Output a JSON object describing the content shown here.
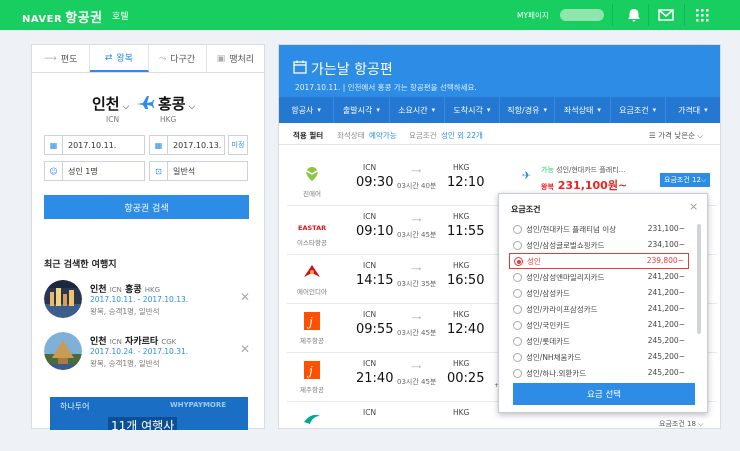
{
  "topbar": {
    "brand": "NAVER",
    "brand_ko": "항공권",
    "nav_hotel": "호텔",
    "mypage": "MY페이지",
    "color": "#19ce60"
  },
  "search": {
    "tabs": [
      {
        "label": "편도",
        "icon": "arrow-right-icon"
      },
      {
        "label": "왕복",
        "icon": "swap-icon",
        "active": true
      },
      {
        "label": "다구간",
        "icon": "multi-city-icon"
      },
      {
        "label": "땡처리",
        "icon": "deal-icon"
      }
    ],
    "from_city": "인천",
    "from_code": "ICN",
    "to_city": "홍콩",
    "to_code": "HKG",
    "depart_date": "2017.10.11.",
    "return_date": "2017.10.13.",
    "undecided": "미정",
    "passengers": "성인 1명",
    "cabin": "일반석",
    "search_button": "항공권 검색"
  },
  "recent": {
    "title": "최근 검색한 여행지",
    "items": [
      {
        "from": "인천",
        "from_code": "ICN",
        "to": "홍콩",
        "to_code": "HKG",
        "dates": "2017.10.11. - 2017.10.13.",
        "info": "왕복, 승객1명, 일반석"
      },
      {
        "from": "인천",
        "from_code": "ICN",
        "to": "자카르타",
        "to_code": "CGK",
        "dates": "2017.10.24. - 2017.10.31.",
        "info": "왕복, 승객1명, 일반석"
      }
    ]
  },
  "ad": {
    "line1": "하나투어",
    "line2": "11개 여행사",
    "line3": "WHYPAYMORE"
  },
  "results": {
    "title": "가는날 항공편",
    "subtitle_date": "2017.10.11.",
    "subtitle_text": "인천에서 홍콩 가는 항공편을 선택하세요.",
    "filters": [
      "항공사",
      "출발시각",
      "소요시간",
      "도착시각",
      "직항/경유",
      "좌석상태",
      "요금조건",
      "가격대"
    ],
    "applied_label": "적용 필터",
    "applied_seat": "좌석상태",
    "applied_seat_value": "예약가능",
    "applied_fare": "요금조건",
    "applied_fare_value": "성인 외 22개",
    "sort": "가격 낮은순",
    "flights": [
      {
        "airline": "진에어",
        "dep_code": "ICN",
        "dep_time": "09:30",
        "duration": "03시간 40분",
        "arr_code": "HKG",
        "arr_time": "12:10",
        "plus_day": "",
        "color": "#8dc63f"
      },
      {
        "airline": "이스타항공",
        "dep_code": "ICN",
        "dep_time": "09:10",
        "duration": "03시간 45분",
        "arr_code": "HKG",
        "arr_time": "11:55",
        "plus_day": "",
        "color": "#d71920"
      },
      {
        "airline": "에어인디아",
        "dep_code": "ICN",
        "dep_time": "14:15",
        "duration": "03시간 35분",
        "arr_code": "HKG",
        "arr_time": "16:50",
        "plus_day": "",
        "color": "#c8102e"
      },
      {
        "airline": "제주항공",
        "dep_code": "ICN",
        "dep_time": "09:55",
        "duration": "03시간 45분",
        "arr_code": "HKG",
        "arr_time": "12:40",
        "plus_day": "",
        "color": "#ff5000"
      },
      {
        "airline": "제주항공",
        "dep_code": "ICN",
        "dep_time": "21:40",
        "duration": "03시간 45분",
        "arr_code": "HKG",
        "arr_time": "00:25",
        "plus_day": "+1일",
        "color": "#ff5000"
      },
      {
        "airline": "",
        "dep_code": "ICN",
        "dep_time": "",
        "duration": "",
        "arr_code": "HKG",
        "arr_time": "",
        "plus_day": "",
        "color": "#00a88f"
      }
    ],
    "first_price_tag": "가능",
    "first_price_desc": "성인/현대카드 플래티...",
    "first_price": "231,100원~",
    "first_price_prefix": "왕복",
    "fare_button": "요금조건 12",
    "bottom_cond": "요금조건 18"
  },
  "popup": {
    "title": "요금조건",
    "close": "×",
    "options": [
      {
        "label": "성인/현대카드 플래티넘 이상",
        "price": "231,100~"
      },
      {
        "label": "성인/삼성글로벌쇼핑카드",
        "price": "234,100~"
      },
      {
        "label": "성인",
        "price": "239,800~",
        "selected": true
      },
      {
        "label": "성인/삼성앤마일리지카드",
        "price": "241,200~"
      },
      {
        "label": "성인/삼성카드",
        "price": "241,200~"
      },
      {
        "label": "성인/카라이프삼성카드",
        "price": "241,200~"
      },
      {
        "label": "성인/국민카드",
        "price": "241,200~"
      },
      {
        "label": "성인/롯데카드",
        "price": "245,200~"
      },
      {
        "label": "성인/NH채움카드",
        "price": "245,200~"
      },
      {
        "label": "성인/하나.외환카드",
        "price": "245,200~"
      }
    ],
    "select_button": "요금 선택"
  }
}
